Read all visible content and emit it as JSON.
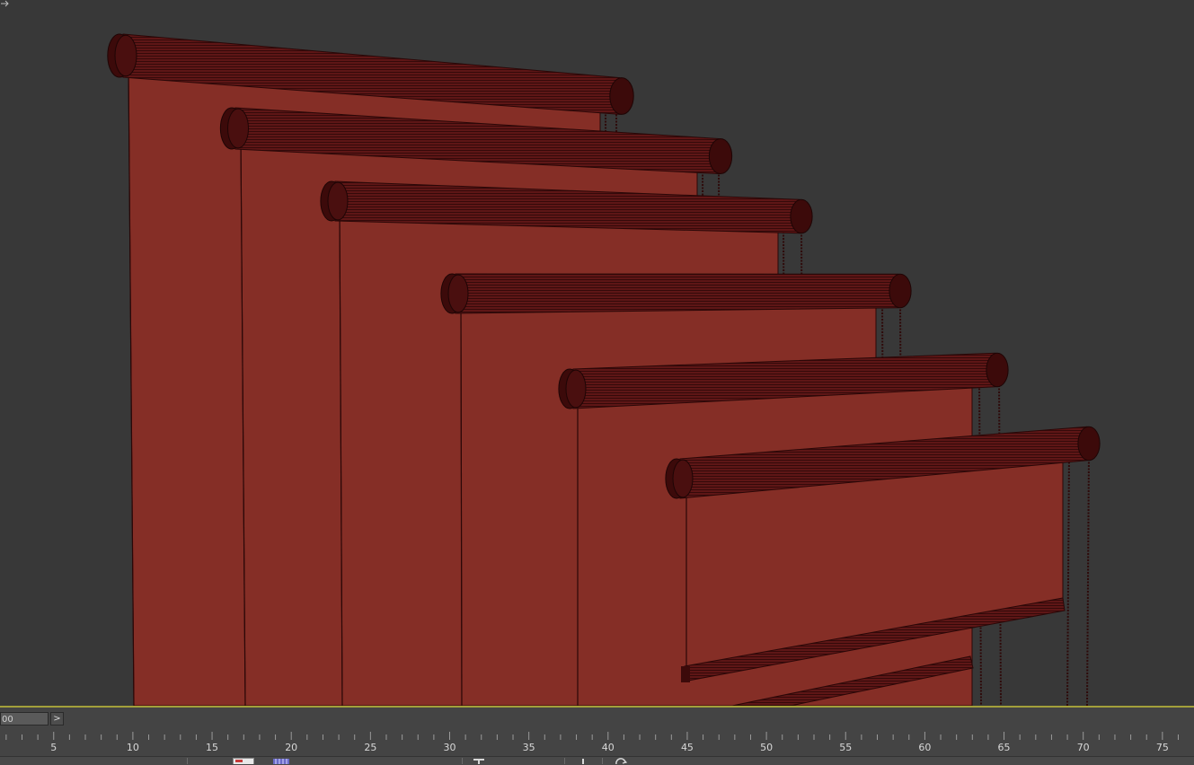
{
  "app": {
    "name": "3D viewport"
  },
  "colors": {
    "viewport_bg": "#383838",
    "blind_fabric": "#852e26",
    "roller_dark": "#3c0a0a",
    "roller_mid": "#5e1616",
    "edge": "#2a0707",
    "viewport_border": "#a3a03a",
    "timeline_bg": "#444444"
  },
  "scene": {
    "object": "roller blinds",
    "count": 6
  },
  "timeslider": {
    "frame_value": "00",
    "next_button": ">"
  },
  "track_bar": {
    "labels": [
      "5",
      "10",
      "15",
      "20",
      "25",
      "30",
      "35",
      "40",
      "45",
      "50",
      "55",
      "60",
      "65",
      "70",
      "75"
    ]
  },
  "toolbar": {
    "icons": [
      "key-filter-icon",
      "track-view-icon",
      "set-key-icon",
      "time-config-icon",
      "rotate-icon"
    ]
  }
}
